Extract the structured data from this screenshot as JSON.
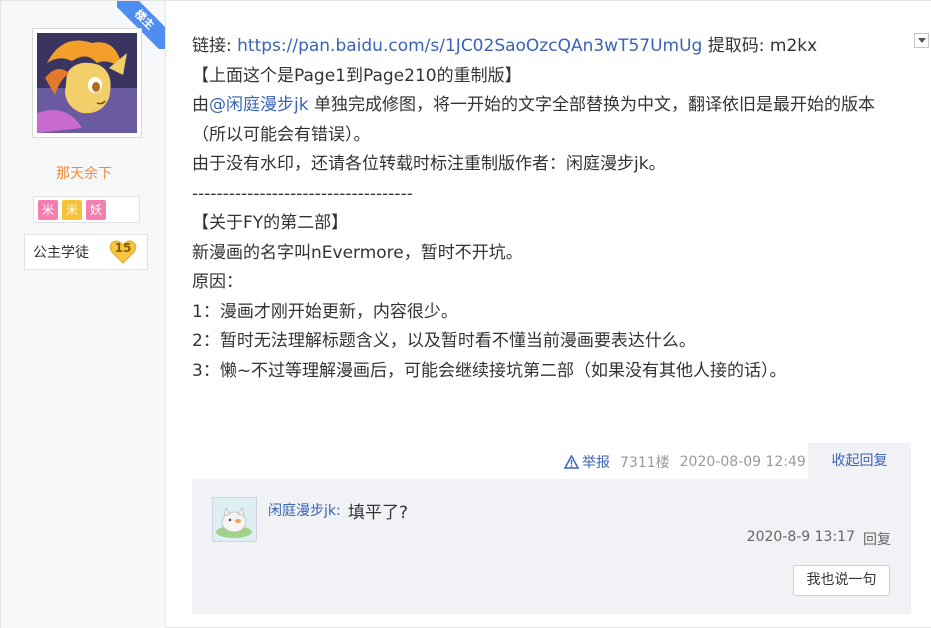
{
  "author": {
    "corner_badge": "楼主",
    "name": "那天余下",
    "badges": [
      "米",
      "米",
      "妖"
    ],
    "level_title": "公主学徒",
    "level": "15"
  },
  "post": {
    "lines": {
      "link_prefix": "链接: ",
      "link_url": "https://pan.baidu.com/s/1JC02SaoOzcQAn3wT57UmUg",
      "code_text": " 提取码: m2kx",
      "line2": "【上面这个是Page1到Page210的重制版】",
      "line3_prefix": "由",
      "line3_mention": "@闲庭漫步jk",
      "line3_rest": " 单独完成修图，将一开始的文字全部替换为中文，翻译依旧是最开始的版本",
      "line4": "（所以可能会有错误）。",
      "line5": "由于没有水印，还请各位转载时标注重制版作者：闲庭漫步jk。",
      "line6": "------------------------------------",
      "line7": "【关于FY的第二部】",
      "line8": "新漫画的名字叫nEvermore，暂时不开坑。",
      "line9": "原因：",
      "line10": "1：漫画才刚开始更新，内容很少。",
      "line11": "2：暂时无法理解标题含义，以及暂时看不懂当前漫画要表达什么。",
      "line12": "3：懒~不过等理解漫画后，可能会继续接坑第二部（如果没有其他人接的话）。"
    },
    "meta": {
      "report": "举报",
      "floor": "7311楼",
      "time": "2020-08-09 12:49",
      "collapse": "收起回复"
    }
  },
  "reply": {
    "user": "闲庭漫步jk:",
    "text": "填平了?",
    "time": "2020-8-9 13:17",
    "reply_label": "回复",
    "say_button": "我也说一句"
  },
  "colors": {
    "link": "#3a63b8",
    "author_name": "#f08a3c",
    "ribbon": "#4f8ef0"
  }
}
